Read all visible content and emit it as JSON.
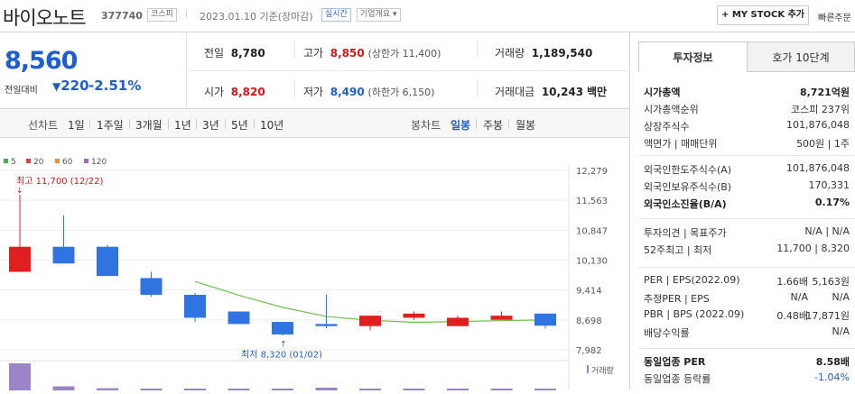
{
  "header": {
    "name": "바이오노트",
    "code": "377740",
    "market": "코스피",
    "date_label": "2023.01.10 기준(장마감)",
    "live_label": "실시간",
    "company_label": "기업개요 ▾",
    "mystock_label": "+ MY STOCK 추가",
    "quick_label": "빠른주문"
  },
  "quote": {
    "price": "8,560",
    "change_label": "전일대비",
    "change_arrow": "▼",
    "change": "220",
    "rate": "-2.51%",
    "prev_label": "전일",
    "prev": "8,780",
    "high_label": "고가",
    "high": "8,850",
    "upper_label": "(상한가 11,400)",
    "vol_label": "거래량",
    "vol": "1,189,540",
    "open_label": "시가",
    "open": "8,820",
    "low_label": "저가",
    "low": "8,490",
    "lower_label": "(하한가 6,150)",
    "amt_label": "거래대금",
    "amt": "10,243",
    "amt_unit": "백만"
  },
  "tabs": {
    "line_label": "선차트",
    "periods": [
      "1일",
      "1주일",
      "3개월",
      "1년",
      "3년",
      "5년",
      "10년"
    ],
    "candle_label": "봉차트",
    "candles": [
      "일봉",
      "주봉",
      "월봉"
    ]
  },
  "chart_data": {
    "type": "candlestick",
    "ma_legend": [
      {
        "name": "5",
        "color": "#40b040"
      },
      {
        "name": "20",
        "color": "#e04040"
      },
      {
        "name": "60",
        "color": "#f08c30"
      },
      {
        "name": "120",
        "color": "#9b6bd0"
      }
    ],
    "y_ticks": [
      "12,279",
      "11,563",
      "10,847",
      "10,130",
      "9,414",
      "8,698",
      "7,982"
    ],
    "ylim": [
      7982,
      12279
    ],
    "candles": [
      {
        "o": 9850,
        "c": 10450,
        "h": 11700,
        "l": 9850
      },
      {
        "o": 10450,
        "c": 10050,
        "h": 11200,
        "l": 10050
      },
      {
        "o": 10450,
        "c": 9750,
        "h": 10500,
        "l": 9750
      },
      {
        "o": 9700,
        "c": 9300,
        "h": 9850,
        "l": 9250
      },
      {
        "o": 9300,
        "c": 8750,
        "h": 9350,
        "l": 8650
      },
      {
        "o": 8900,
        "c": 8600,
        "h": 8900,
        "l": 8600
      },
      {
        "o": 8650,
        "c": 8350,
        "h": 8650,
        "l": 8320
      },
      {
        "o": 8600,
        "c": 8550,
        "h": 9300,
        "l": 8500
      },
      {
        "o": 8550,
        "c": 8800,
        "h": 8800,
        "l": 8450
      },
      {
        "o": 8750,
        "c": 8850,
        "h": 8900,
        "l": 8700
      },
      {
        "o": 8550,
        "c": 8750,
        "h": 8800,
        "l": 8550
      },
      {
        "o": 8700,
        "c": 8800,
        "h": 8900,
        "l": 8700
      },
      {
        "o": 8850,
        "c": 8560,
        "h": 8850,
        "l": 8490
      }
    ],
    "ma5": [
      null,
      null,
      null,
      null,
      9620,
      9290,
      9000,
      8780,
      8690,
      8640,
      8660,
      8680,
      8700
    ],
    "volume": [
      100,
      15,
      8,
      6,
      6,
      5,
      6,
      10,
      4,
      4,
      3,
      4,
      3
    ],
    "high_annot": "최고 11,700 (12/22)",
    "low_annot": "최저 8,320 (01/02)",
    "vol_label": "거래량"
  },
  "side": {
    "tab1": "투자정보",
    "tab2": "호가 10단계",
    "rows1": [
      {
        "k": "시가총액",
        "v": "8,721억원",
        "bold": true
      },
      {
        "k": "시가총액순위",
        "v": "코스피 237위"
      },
      {
        "k": "상장주식수",
        "v": "101,876,048"
      },
      {
        "k": "액면가 | 매매단위",
        "v": "500원 | 1주"
      }
    ],
    "rows2": [
      {
        "k": "외국인한도주식수(A)",
        "v": "101,876,048"
      },
      {
        "k": "외국인보유주식수(B)",
        "v": "170,331"
      },
      {
        "k": "외국인소진율(B/A)",
        "v": "0.17%",
        "bold": true
      }
    ],
    "rows3": [
      {
        "k": "투자의견 | 목표주가",
        "v": "N/A | N/A"
      },
      {
        "k": "52주최고 | 최저",
        "v": "11,700 | 8,320"
      }
    ],
    "rows4": [
      {
        "k": "PER | EPS(2022.09)",
        "v1": "1.66배",
        "v": "5,163원"
      },
      {
        "k": "추정PER | EPS",
        "v1": "N/A",
        "v": "N/A"
      },
      {
        "k": "PBR | BPS (2022.09)",
        "v1": "0.48배",
        "v": "17,871원"
      },
      {
        "k": "배당수익률",
        "v": "N/A"
      }
    ],
    "rows5": [
      {
        "k": "동일업종 PER",
        "v": "8.58배",
        "bold": true
      },
      {
        "k": "동일업종 등락률",
        "v": "-1.04%",
        "blue": true
      }
    ]
  }
}
